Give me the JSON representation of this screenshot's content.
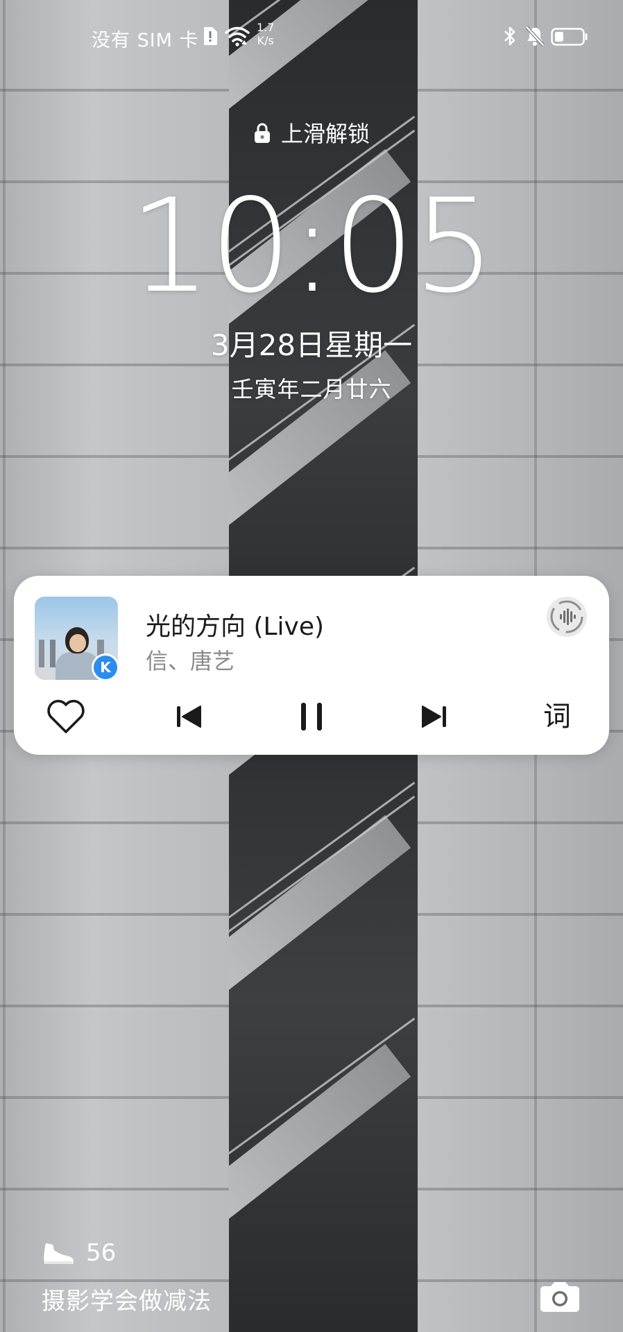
{
  "status_bar": {
    "carrier": "没有 SIM 卡",
    "net_speed_value": "1.7",
    "net_speed_unit": "K/s"
  },
  "lock_screen": {
    "unlock_hint": "上滑解锁",
    "time": "10:05",
    "date": "3月28日星期一",
    "lunar_date": "壬寅年二月廿六"
  },
  "media_card": {
    "title": "光的方向 (Live)",
    "artist": "信、唐艺",
    "app_badge_letter": "K",
    "lyrics_label": "词",
    "accent_color": "#2b8cf0"
  },
  "footer": {
    "steps": "56",
    "caption": "摄影学会做减法"
  }
}
